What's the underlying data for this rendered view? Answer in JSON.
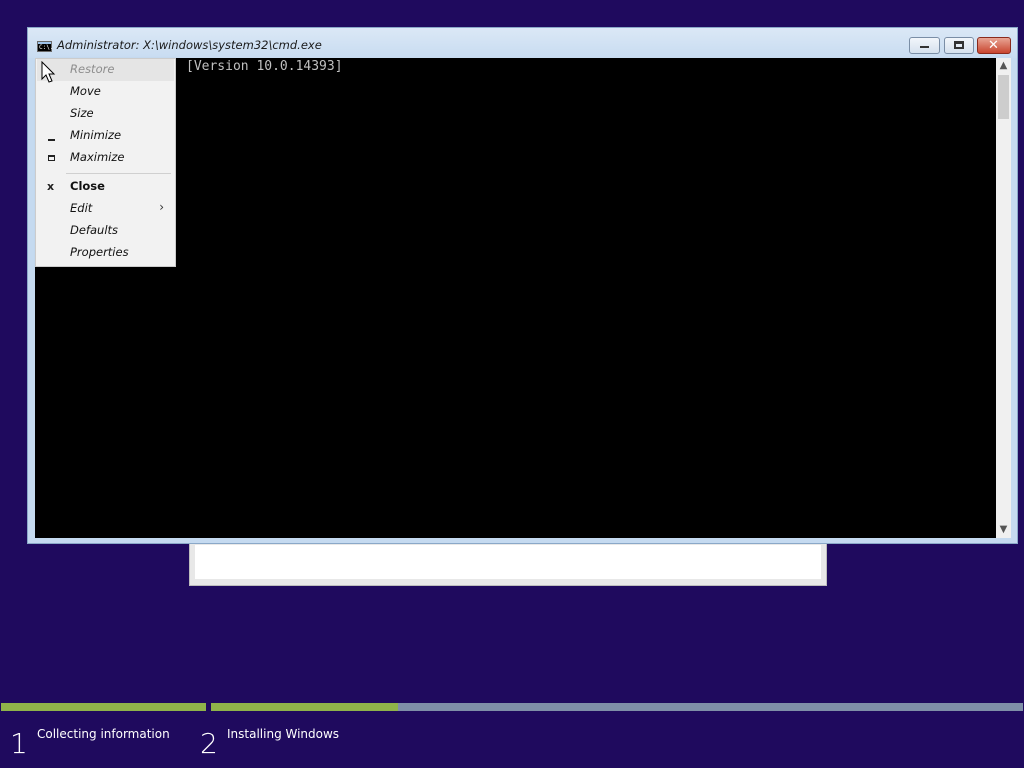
{
  "cmd_window": {
    "title": "Administrator: X:\\windows\\system32\\cmd.exe",
    "icon_text": "C:\\.",
    "console_line": "[Version 10.0.14393]",
    "controls": {
      "minimize": "minimize-icon",
      "maximize": "maximize-icon",
      "close_glyph": "✕"
    }
  },
  "system_menu": {
    "items": [
      {
        "label": "Restore",
        "state": "disabled",
        "icon": ""
      },
      {
        "label": "Move",
        "state": "normal",
        "icon": ""
      },
      {
        "label": "Size",
        "state": "normal",
        "icon": ""
      },
      {
        "label": "Minimize",
        "state": "normal",
        "icon": "minimize-icon"
      },
      {
        "label": "Maximize",
        "state": "normal",
        "icon": "maximize-icon"
      },
      {
        "label": "Close",
        "state": "default",
        "icon": "close-icon",
        "glyph": "x"
      },
      {
        "label": "Edit",
        "state": "submenu",
        "icon": "chevron-right-icon",
        "arrow": "›"
      },
      {
        "label": "Defaults",
        "state": "normal",
        "icon": ""
      },
      {
        "label": "Properties",
        "state": "normal",
        "icon": ""
      }
    ]
  },
  "setup_progress": {
    "steps": [
      {
        "number": "1",
        "label": "Collecting information"
      },
      {
        "number": "2",
        "label": "Installing Windows"
      }
    ],
    "step1_complete": 1.0,
    "step2_progress": 0.23,
    "colors": {
      "background": "#1f0a5e",
      "progress_fill": "#8fb34a",
      "progress_track": "#7f8fa8"
    }
  }
}
